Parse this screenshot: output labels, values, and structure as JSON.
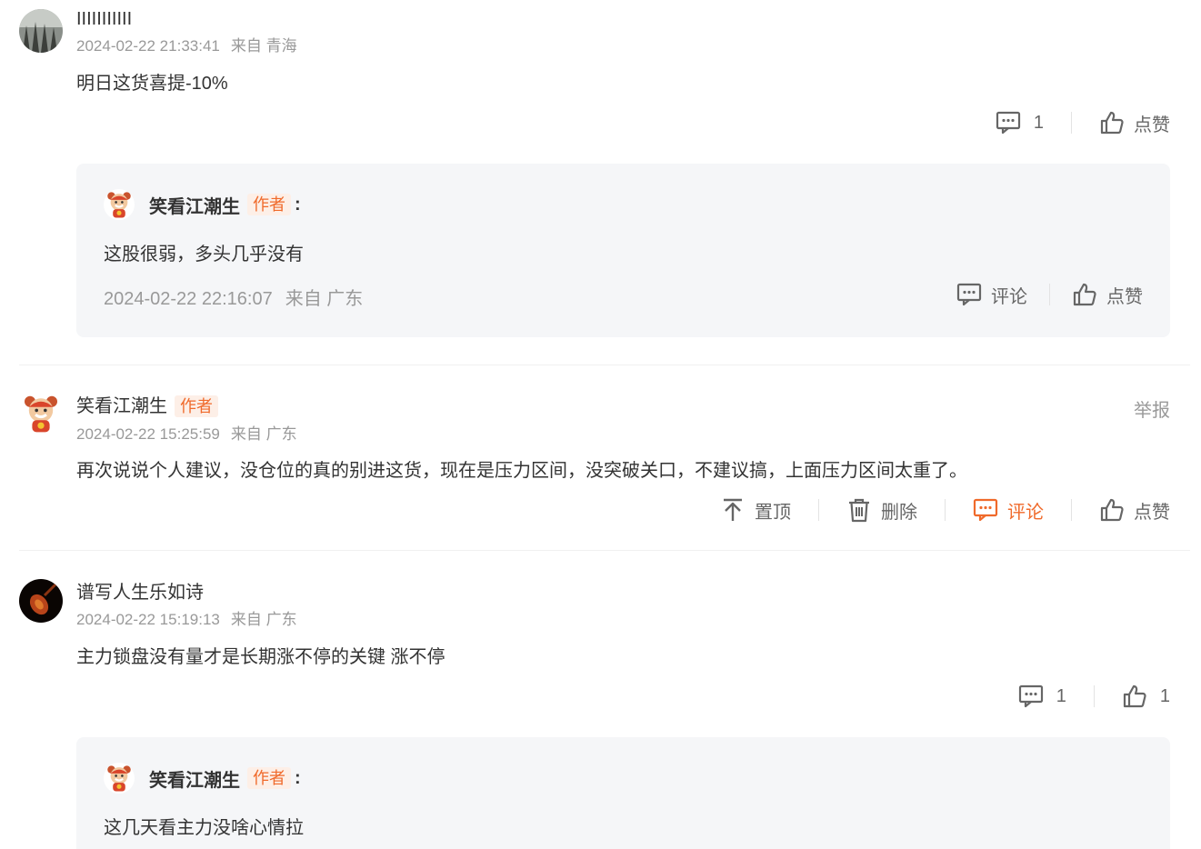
{
  "comments": [
    {
      "username": "IIIIIIIIIII",
      "time": "2024-02-22 21:33:41",
      "location": "来自 青海",
      "content": "明日这货喜提-10%",
      "reply_count": "1",
      "like_label": "点赞",
      "reply": {
        "username": "笑看江潮生",
        "author_tag": "作者",
        "colon": ":",
        "content": "这股很弱，多头几乎没有",
        "time": "2024-02-22 22:16:07",
        "location": "来自 广东",
        "comment_label": "评论",
        "like_label": "点赞"
      }
    },
    {
      "username": "笑看江潮生",
      "author_tag": "作者",
      "report_label": "举报",
      "time": "2024-02-22 15:25:59",
      "location": "来自 广东",
      "content": "再次说说个人建议，没仓位的真的别进这货，现在是压力区间，没突破关口，不建议搞，上面压力区间太重了。",
      "pin_label": "置顶",
      "delete_label": "删除",
      "comment_label": "评论",
      "like_label": "点赞"
    },
    {
      "username": "谱写人生乐如诗",
      "time": "2024-02-22 15:19:13",
      "location": "来自 广东",
      "content": "主力锁盘没有量才是长期涨不停的关键 涨不停",
      "reply_count": "1",
      "like_count": "1",
      "reply": {
        "username": "笑看江潮生",
        "author_tag": "作者",
        "colon": ":",
        "content": "这几天看主力没啥心情拉"
      }
    }
  ],
  "colors": {
    "accent": "#f06a2b",
    "meta_gray": "#999999",
    "reply_bg": "#f5f6f8"
  }
}
